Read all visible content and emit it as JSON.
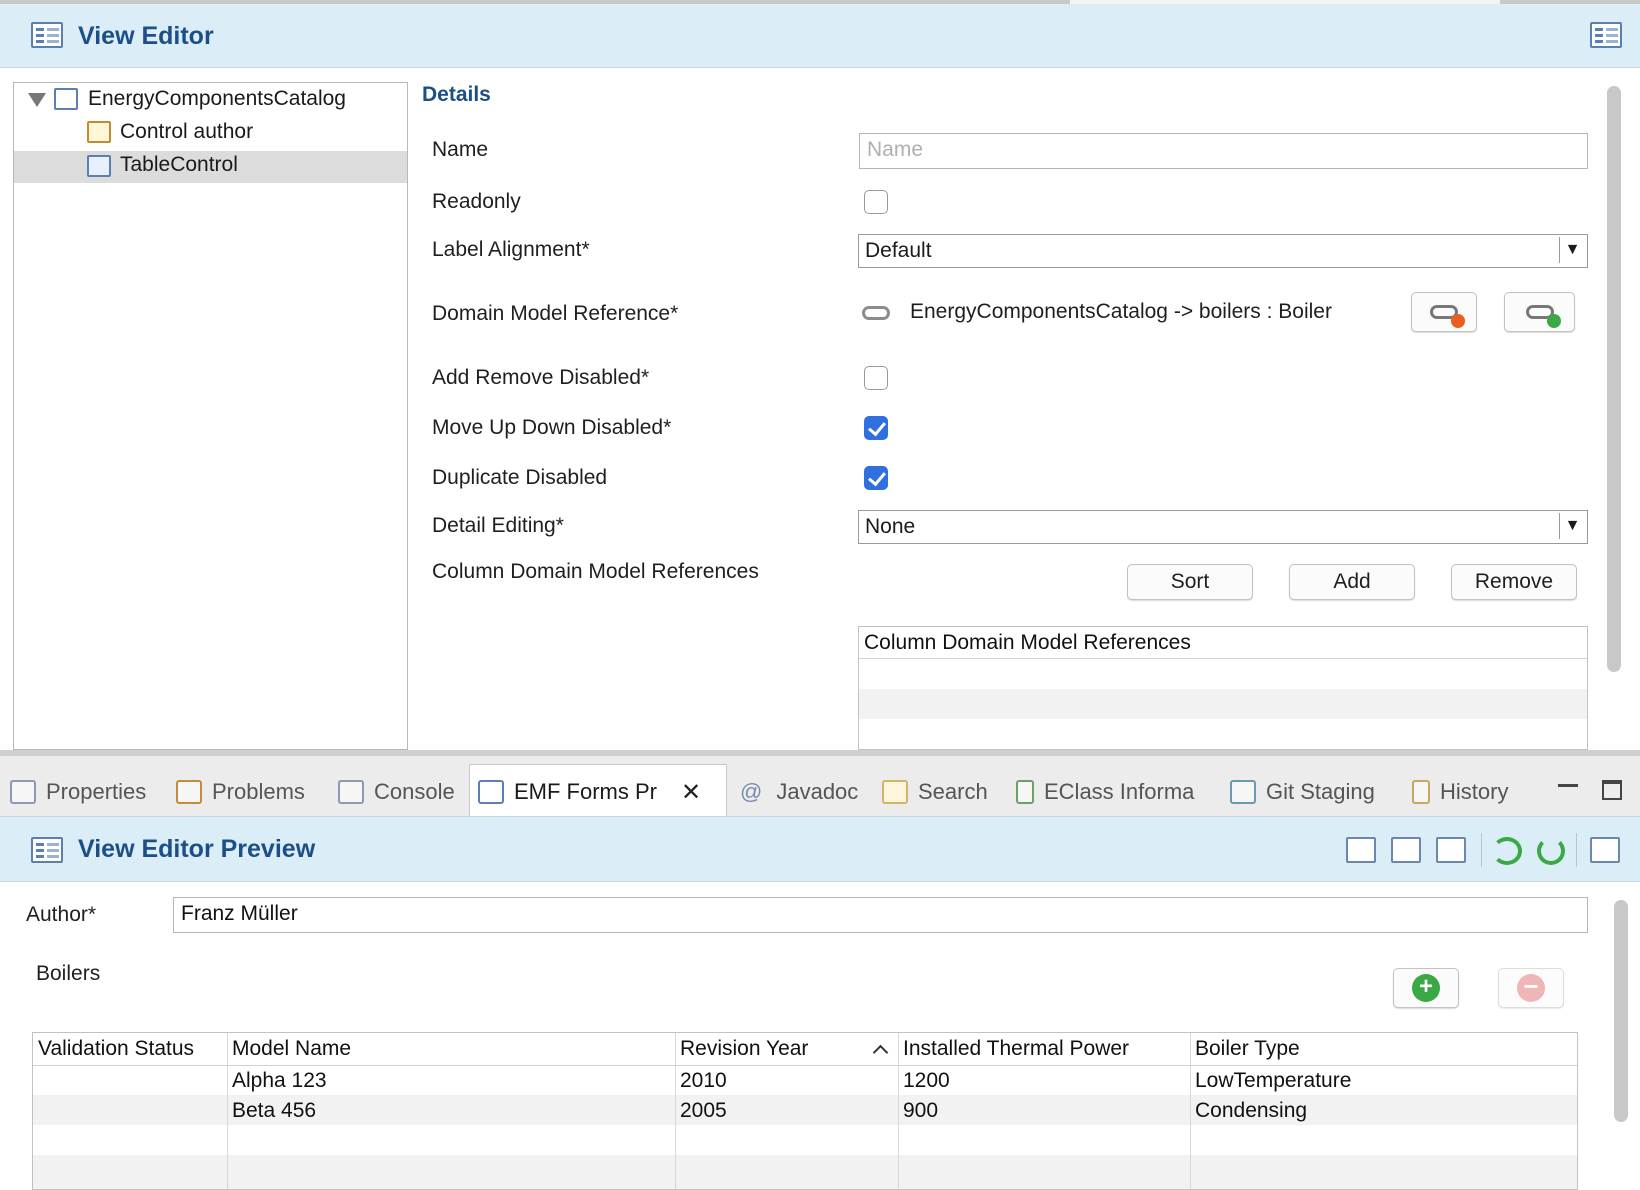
{
  "editor": {
    "title": "View Editor",
    "tree": [
      {
        "label": "EnergyComponentsCatalog"
      },
      {
        "label": "Control author"
      },
      {
        "label": "TableControl"
      }
    ],
    "details_heading": "Details",
    "fields": {
      "name_label": "Name",
      "name_placeholder": "Name",
      "readonly_label": "Readonly",
      "label_alignment_label": "Label Alignment*",
      "label_alignment_value": "Default",
      "domain_model_reference_label": "Domain Model Reference*",
      "domain_model_reference_value": "EnergyComponentsCatalog -> boilers : Boiler",
      "add_remove_disabled_label": "Add Remove Disabled*",
      "add_remove_disabled_checked": false,
      "move_up_down_disabled_label": "Move Up Down Disabled*",
      "move_up_down_disabled_checked": true,
      "duplicate_disabled_label": "Duplicate Disabled",
      "duplicate_disabled_checked": true,
      "detail_editing_label": "Detail Editing*",
      "detail_editing_value": "None",
      "column_refs_label": "Column Domain Model References",
      "sort_label": "Sort",
      "add_label": "Add",
      "remove_label": "Remove",
      "column_refs_table_header": "Column Domain Model References"
    }
  },
  "tabs": [
    {
      "label": "Properties",
      "icon": "properties-icon"
    },
    {
      "label": "Problems",
      "icon": "problems-icon"
    },
    {
      "label": "Console",
      "icon": "console-icon"
    },
    {
      "label": "EMF Forms Pr",
      "icon": "emf-forms-icon",
      "active": true
    },
    {
      "label": "Javadoc",
      "icon": "javadoc-icon"
    },
    {
      "label": "Search",
      "icon": "search-icon"
    },
    {
      "label": "EClass Informa",
      "icon": "eclass-icon"
    },
    {
      "label": "Git Staging",
      "icon": "git-staging-icon"
    },
    {
      "label": "History",
      "icon": "history-icon"
    }
  ],
  "preview": {
    "title": "View Editor Preview",
    "author_label": "Author*",
    "author_value": "Franz Müller",
    "boilers_label": "Boilers",
    "table": {
      "columns": [
        "Validation Status",
        "Model Name",
        "Revision Year",
        "Installed Thermal Power",
        "Boiler Type"
      ],
      "rows": [
        [
          "",
          "Alpha 123",
          "2010",
          "1200",
          "LowTemperature"
        ],
        [
          "",
          "Beta 456",
          "2005",
          "900",
          "Condensing"
        ]
      ]
    }
  },
  "colors": {
    "header_bg": "#dbeef8",
    "title_color": "#1c4f86",
    "checkbox_checked": "#2f6fe0"
  }
}
